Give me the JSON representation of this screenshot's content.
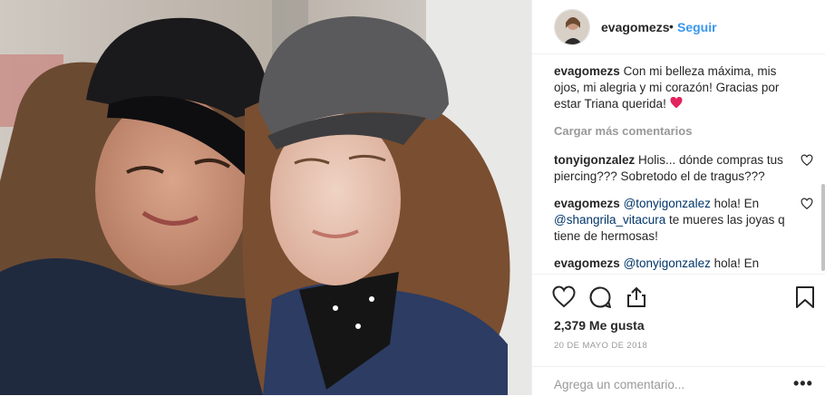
{
  "post": {
    "username": "evagomezs",
    "separator": "•",
    "follow_label": "Seguir",
    "likes_label": "2,379 Me gusta",
    "date": "20 de mayo de 2018",
    "add_comment_placeholder": "Agrega un comentario...",
    "more_options": "•••"
  },
  "comments": {
    "load_more": "Cargar más comentarios",
    "caption": {
      "user": "evagomezs",
      "text": "Con mi belleza máxima, mis ojos, mi alegria y mi corazón! Gracias por estar Triana querida!"
    },
    "items": [
      {
        "user": "tonyigonzalez",
        "text": "Holis... dónde compras tus piercing??? Sobretodo el de tragus???"
      },
      {
        "user": "evagomezs",
        "mention1": "@tonyigonzalez",
        "text1": "hola! En",
        "mention2": "@shangrila_vitacura",
        "text2": "te mueres las joyas q tiene de hermosas!"
      },
      {
        "user": "evagomezs",
        "mention1": "@tonyigonzalez",
        "text1": "hola! En"
      }
    ]
  },
  "icons": {
    "like": "heart-outline-icon",
    "comment": "speech-bubble-icon",
    "share": "share-icon",
    "save": "bookmark-icon",
    "caption_emoji": "red-heart-emoji"
  },
  "colors": {
    "link": "#3897f0",
    "mention": "#003569",
    "muted": "#999999",
    "text": "#262626",
    "heart": "#ed4956"
  }
}
